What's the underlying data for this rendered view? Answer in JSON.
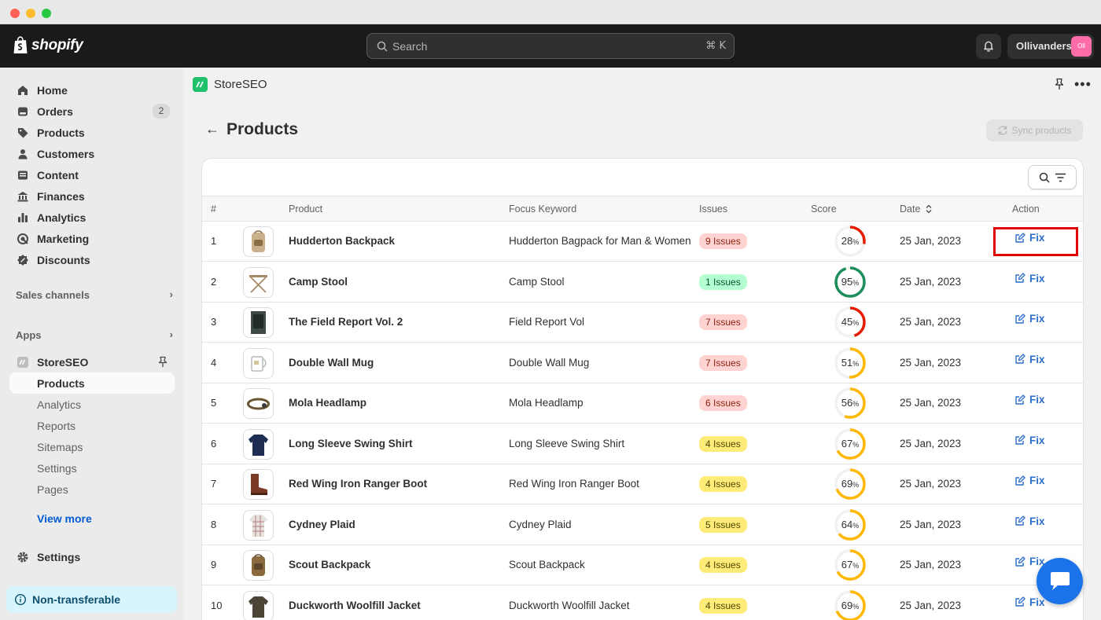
{
  "topbar": {
    "brand": "shopify",
    "search_placeholder": "Search",
    "search_shortcut": "⌘ K",
    "store_name": "Ollivanders",
    "store_avatar": "Oll"
  },
  "sidebar": {
    "items": [
      {
        "label": "Home",
        "icon": "home-icon"
      },
      {
        "label": "Orders",
        "icon": "orders-icon",
        "badge": "2"
      },
      {
        "label": "Products",
        "icon": "tag-icon"
      },
      {
        "label": "Customers",
        "icon": "person-icon"
      },
      {
        "label": "Content",
        "icon": "content-icon"
      },
      {
        "label": "Finances",
        "icon": "bank-icon"
      },
      {
        "label": "Analytics",
        "icon": "bar-chart-icon"
      },
      {
        "label": "Marketing",
        "icon": "target-icon"
      },
      {
        "label": "Discounts",
        "icon": "discount-icon"
      }
    ],
    "sales_channels": "Sales channels",
    "apps": "Apps",
    "app_name": "StoreSEO",
    "app_subitems": [
      "Products",
      "Analytics",
      "Reports",
      "Sitemaps",
      "Settings",
      "Pages"
    ],
    "view_more": "View more",
    "settings": "Settings",
    "non_transferable": "Non-transferable"
  },
  "main": {
    "app_name": "StoreSEO",
    "page_title": "Products",
    "sync_button": "Sync products",
    "columns": [
      "#",
      "Product",
      "Focus Keyword",
      "Issues",
      "Score",
      "Date",
      "Action"
    ],
    "rows": [
      {
        "num": "1",
        "product": "Hudderton Backpack",
        "keyword": "Hudderton Bagpack for Man & Women",
        "issues": "9 Issues",
        "score": "28",
        "date": "25 Jan, 2023",
        "action": "Fix"
      },
      {
        "num": "2",
        "product": "Camp Stool",
        "keyword": "Camp Stool",
        "issues": "1 Issues",
        "score": "95",
        "date": "25 Jan, 2023",
        "action": "Fix"
      },
      {
        "num": "3",
        "product": "The Field Report Vol. 2",
        "keyword": "Field Report Vol",
        "issues": "7 Issues",
        "score": "45",
        "date": "25 Jan, 2023",
        "action": "Fix"
      },
      {
        "num": "4",
        "product": "Double Wall Mug",
        "keyword": "Double Wall Mug",
        "issues": "7 Issues",
        "score": "51",
        "date": "25 Jan, 2023",
        "action": "Fix"
      },
      {
        "num": "5",
        "product": "Mola Headlamp",
        "keyword": "Mola Headlamp",
        "issues": "6 Issues",
        "score": "56",
        "date": "25 Jan, 2023",
        "action": "Fix"
      },
      {
        "num": "6",
        "product": "Long Sleeve Swing Shirt",
        "keyword": "Long Sleeve Swing Shirt",
        "issues": "4 Issues",
        "score": "67",
        "date": "25 Jan, 2023",
        "action": "Fix"
      },
      {
        "num": "7",
        "product": "Red Wing Iron Ranger Boot",
        "keyword": "Red Wing Iron Ranger Boot",
        "issues": "4 Issues",
        "score": "69",
        "date": "25 Jan, 2023",
        "action": "Fix"
      },
      {
        "num": "8",
        "product": "Cydney Plaid",
        "keyword": "Cydney Plaid",
        "issues": "5 Issues",
        "score": "64",
        "date": "25 Jan, 2023",
        "action": "Fix"
      },
      {
        "num": "9",
        "product": "Scout Backpack",
        "keyword": "Scout Backpack",
        "issues": "4 Issues",
        "score": "67",
        "date": "25 Jan, 2023",
        "action": "Fix"
      },
      {
        "num": "10",
        "product": "Duckworth Woolfill Jacket",
        "keyword": "Duckworth Woolfill Jacket",
        "issues": "4 Issues",
        "score": "69",
        "date": "25 Jan, 2023",
        "action": "Fix"
      }
    ]
  },
  "colors": {
    "accent": "#2c6ecb",
    "score_low": "#e51c00",
    "score_mid": "#ffb800",
    "score_high": "#1a8f5c",
    "badge_critical_bg": "#fed3d1",
    "badge_warning_bg": "#ffeb78",
    "badge_success_bg": "#b4fed2"
  }
}
